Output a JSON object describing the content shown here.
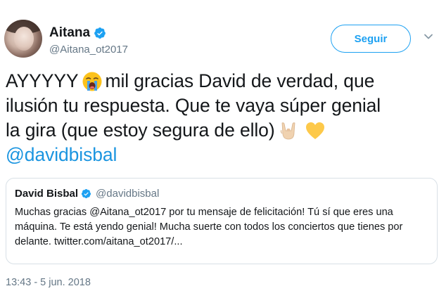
{
  "author": {
    "display_name": "Aitana",
    "handle": "@Aitana_ot2017",
    "verified_icon": "verified-badge-icon",
    "avatar_icon": "avatar-photo"
  },
  "follow_button": {
    "label": "Seguir"
  },
  "menu_icon": "chevron-down-icon",
  "tweet": {
    "line1_before": "AYYYYY",
    "line1_emoji": "crying-face-emoji",
    "line1_after": "mil gracias David de verdad, que",
    "line2": "ilusión tu respuesta. Que te vaya súper genial",
    "line3": "la gira (que estoy segura de ello)",
    "line3_emojis": [
      "sign-of-horns-emoji",
      "yellow-heart-emoji"
    ],
    "mention": "@davidbisbal"
  },
  "quoted_tweet": {
    "display_name": "David Bisbal",
    "handle": "@davidbisbal",
    "line1": "Muchas gracias @Aitana_ot2017 por tu mensaje de felicitación! Tú sí que eres una",
    "line2": "máquina. Te está yendo genial! Mucha suerte con todos los conciertos que tienes por",
    "line3": "delante. twitter.com/aitana_ot2017/..."
  },
  "timestamp": "13:43 - 5 jun. 2018",
  "colors": {
    "accent": "#1da1f2",
    "link": "#1b95e0",
    "muted": "#657786",
    "border": "#d8e0e6"
  }
}
